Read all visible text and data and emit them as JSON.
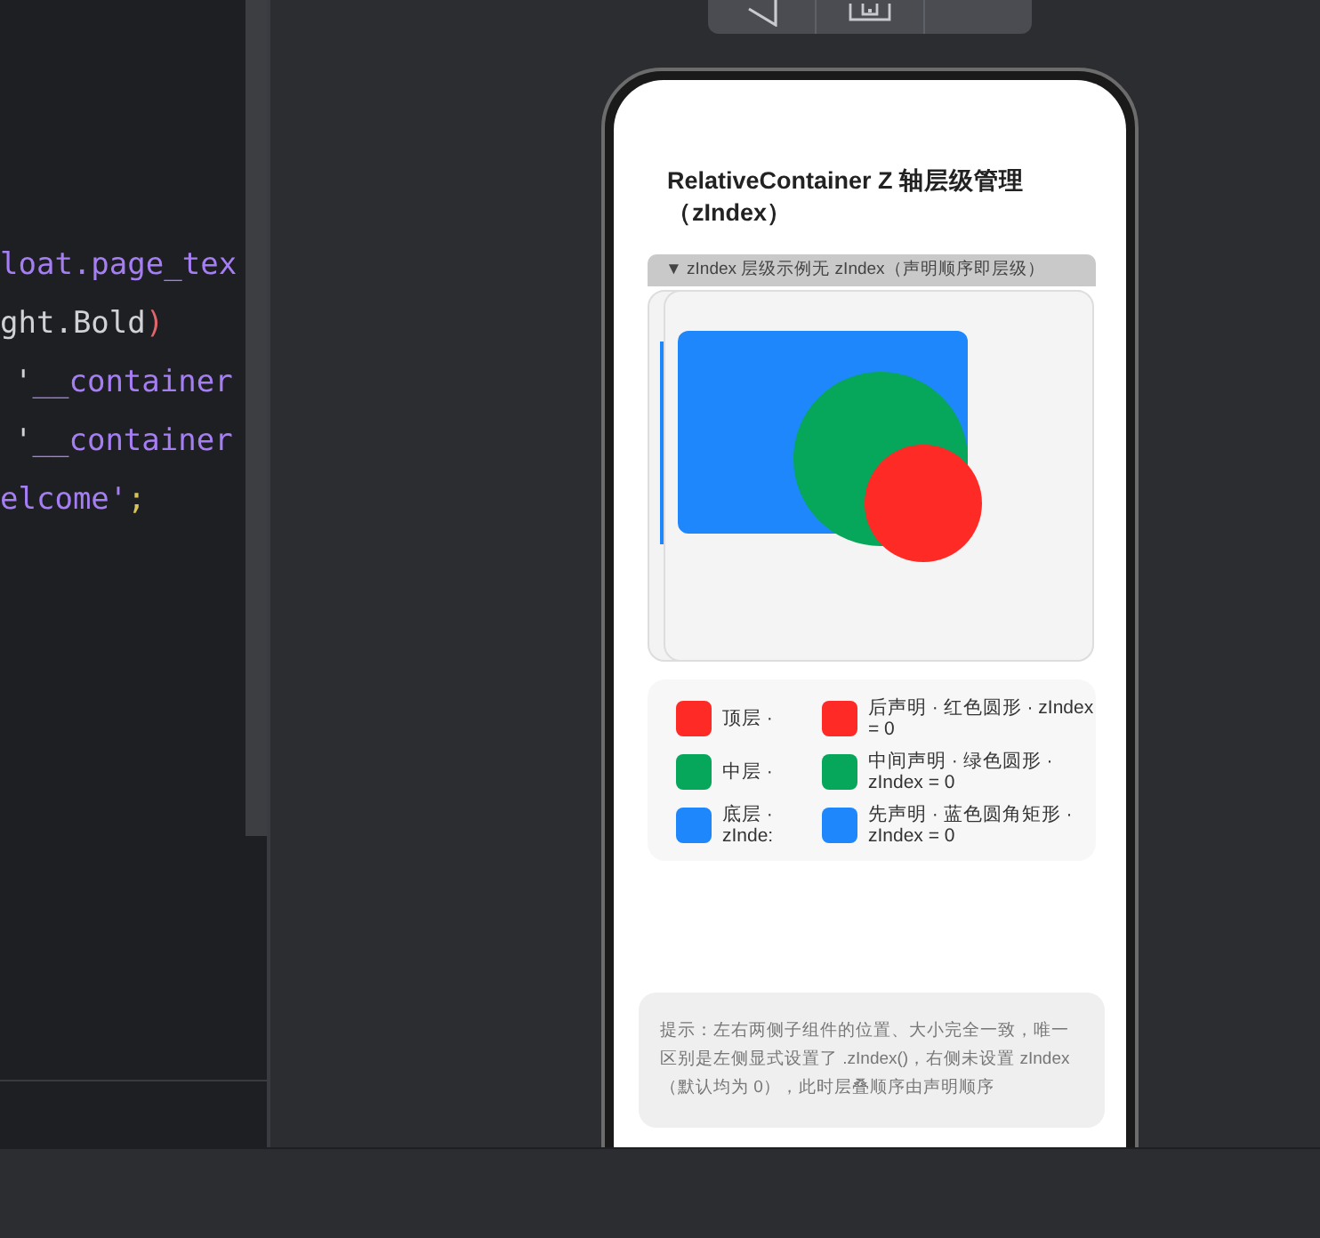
{
  "editor": {
    "code_lines": [
      {
        "tokens": [
          {
            "text": "loat.page_tex",
            "kind": "ident"
          }
        ],
        "kind": "flush"
      },
      {
        "tokens": [
          {
            "text": "ght.Bold",
            "kind": "plain"
          },
          {
            "text": ")",
            "kind": "paren"
          }
        ],
        "kind": "flush"
      },
      {
        "tokens": [
          {
            "text": "'",
            "kind": "plain"
          },
          {
            "text": "__container",
            "kind": "ident"
          }
        ],
        "kind": "indented"
      },
      {
        "tokens": [
          {
            "text": "'",
            "kind": "plain"
          },
          {
            "text": "__container",
            "kind": "ident"
          }
        ],
        "kind": "indented"
      },
      {
        "tokens": [
          {
            "text": "elcome'",
            "kind": "ident"
          },
          {
            "text": ";",
            "kind": "punct"
          }
        ],
        "kind": "flush"
      }
    ]
  },
  "preview": {
    "title": "RelativeContainer  Z 轴层级管理（zIndex）",
    "section_header": "▼ zIndex 层级示例无 zIndex（声明顺序即层级）",
    "legend": [
      {
        "left_label": "顶层 ·",
        "right_label": "后声明 · 红色圆形 · zIndex = 0",
        "color": "#fe2a26"
      },
      {
        "left_label": "中层 ·",
        "right_label": "中间声明 · 绿色圆形 · zIndex = 0",
        "color": "#07a75b"
      },
      {
        "left_label": "底层 · zInde:",
        "right_label": "先声明 · 蓝色圆角矩形 · zIndex = 0",
        "color": "#1e87fb"
      }
    ],
    "tip": "提示：左右两侧子组件的位置、大小完全一致，唯一区别是左侧显式设置了 .zIndex()，右侧未设置 zIndex（默认均为 0），此时层叠顺序由声明顺序"
  }
}
